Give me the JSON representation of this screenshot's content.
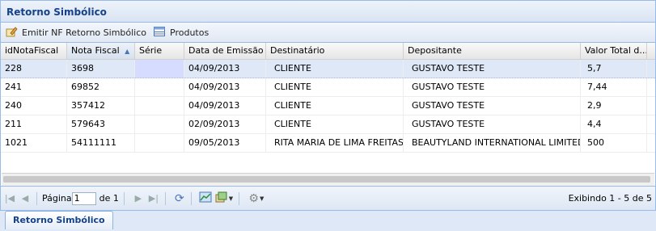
{
  "panel": {
    "title": "Retorno Simbólico"
  },
  "toolbar": {
    "emitir_label": "Emitir NF Retorno Simbólico",
    "produtos_label": "Produtos"
  },
  "grid": {
    "columns": [
      "idNotaFiscal",
      "Nota Fiscal",
      "Série",
      "Data de Emissão",
      "Destinatário",
      "Depositante",
      "Valor Total d..."
    ],
    "rows": [
      [
        "228",
        "3698",
        "",
        "04/09/2013",
        "CLIENTE",
        "GUSTAVO TESTE",
        "5,7"
      ],
      [
        "241",
        "69852",
        "",
        "04/09/2013",
        "CLIENTE",
        "GUSTAVO TESTE",
        "7,44"
      ],
      [
        "240",
        "357412",
        "",
        "04/09/2013",
        "CLIENTE",
        "GUSTAVO TESTE",
        "2,9"
      ],
      [
        "211",
        "579643",
        "",
        "02/09/2013",
        "CLIENTE",
        "GUSTAVO TESTE",
        "4,4"
      ],
      [
        "1021",
        "54111111",
        "",
        "09/05/2013",
        "RITA MARIA DE LIMA FREITAS",
        "BEAUTYLAND INTERNATIONAL LIMITED",
        "500"
      ]
    ]
  },
  "pager": {
    "page_label": "Página",
    "page_value": "1",
    "of_label": "de 1",
    "display_text": "Exibindo 1 - 5 de 5"
  },
  "tabs": {
    "active": "Retorno Simbólico"
  },
  "colors": {
    "accent": "#15428b",
    "selected_row": "#dfe8f6",
    "border": "#99bbe8"
  }
}
